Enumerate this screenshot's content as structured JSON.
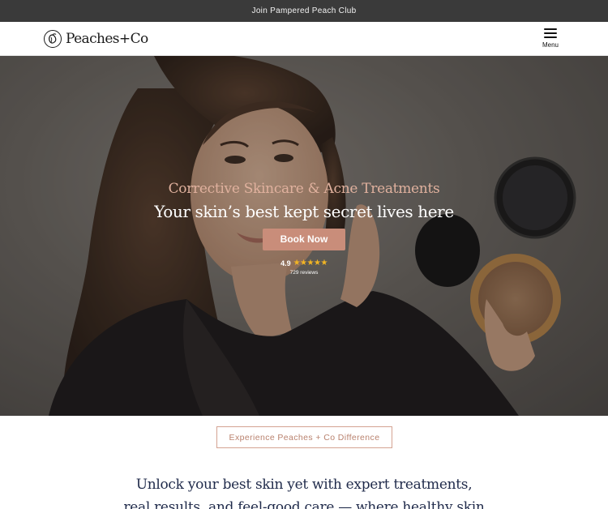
{
  "announcement": {
    "text": "Join Pampered Peach Club"
  },
  "header": {
    "logo_text": "Peaches+Co",
    "menu_label": "Menu"
  },
  "hero": {
    "eyebrow": "Corrective Skincare & Acne Treatments",
    "title": "Your skin’s best kept secret lives here",
    "cta_label": "Book Now",
    "rating": {
      "score": "4.9",
      "stars": "★★★★★",
      "reviews": "729 reviews"
    }
  },
  "difference_button": {
    "label": "Experience Peaches + Co Difference"
  },
  "intro": {
    "line1": "Unlock your best skin yet with expert treatments,",
    "line2": "real results, and feel-good care — where healthy skin"
  },
  "colors": {
    "announcement_bg": "#3a3a3a",
    "accent": "#c98d7a",
    "star": "#f2b524",
    "heading_navy": "#1f2a4a"
  }
}
